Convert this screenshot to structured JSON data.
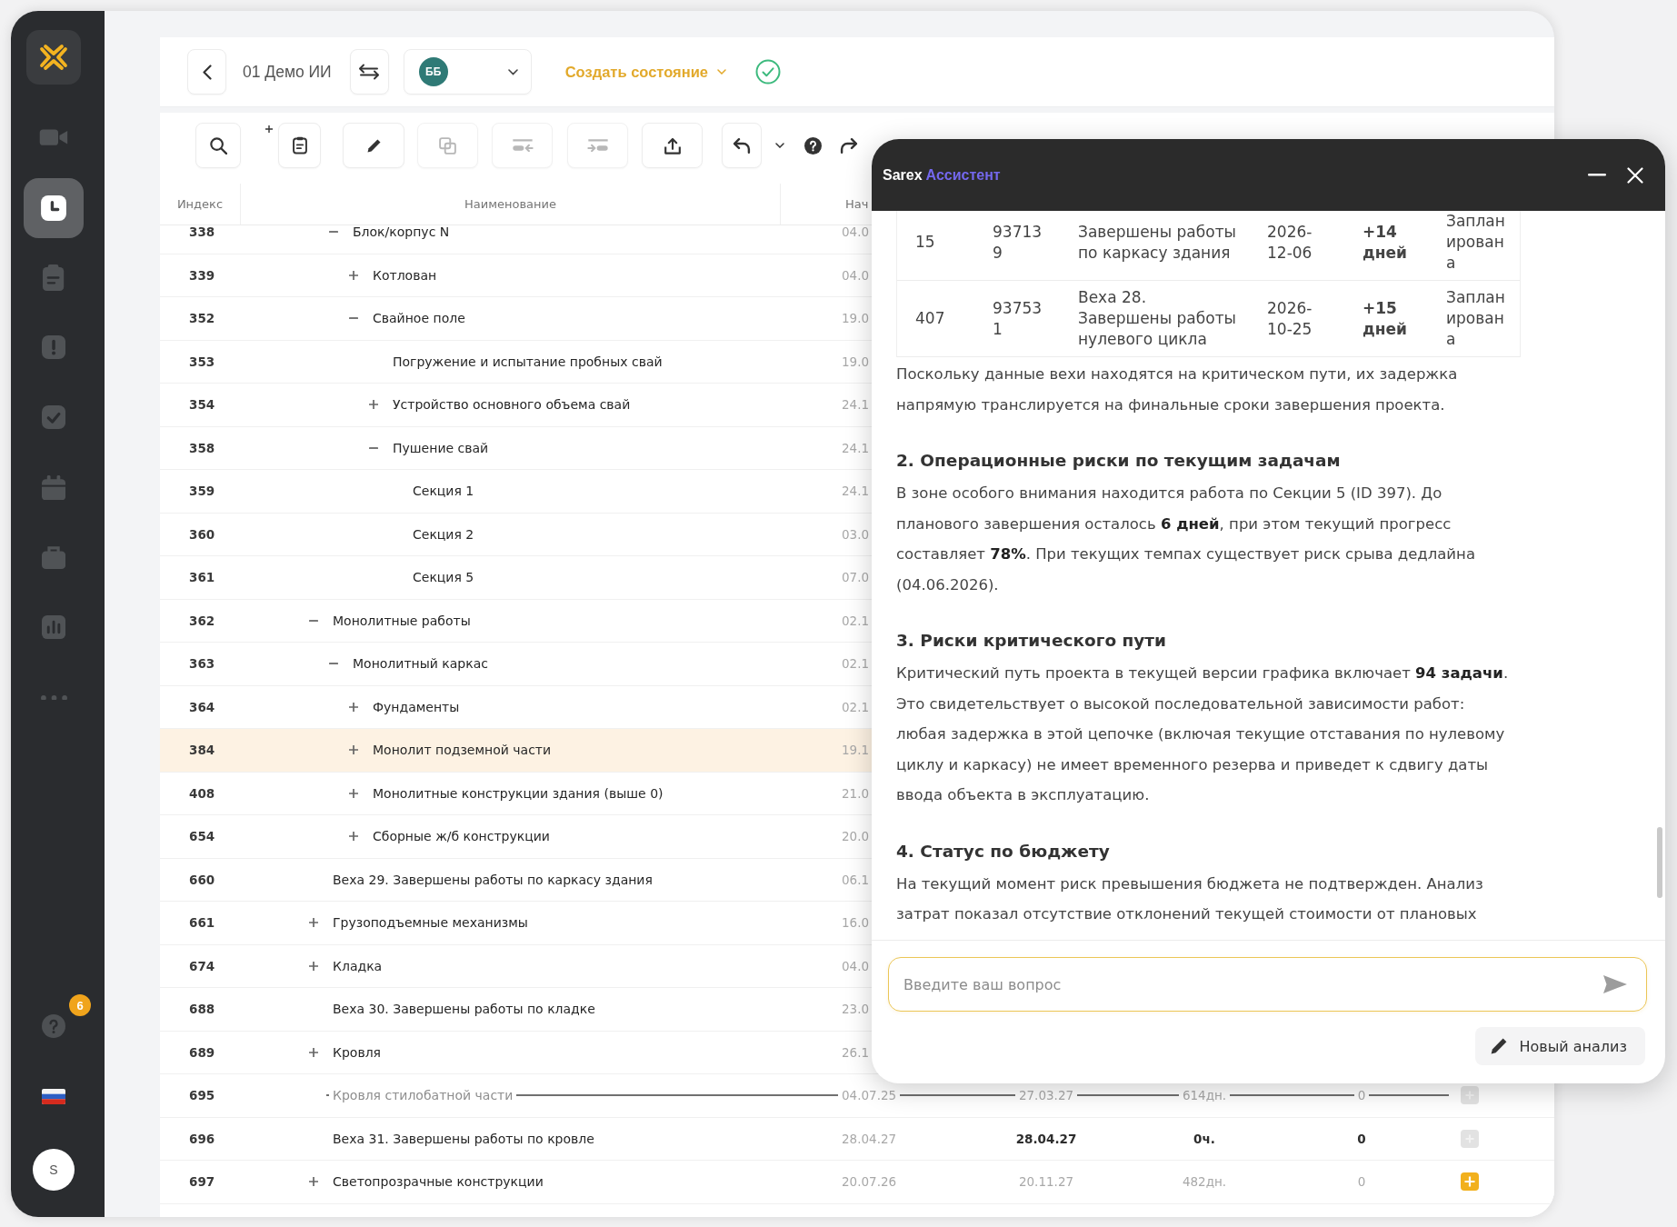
{
  "sidebar": {
    "nav_items": [
      {
        "selected": false
      },
      {
        "selected": true
      },
      {
        "selected": false
      },
      {
        "selected": false
      },
      {
        "selected": false
      },
      {
        "selected": false
      },
      {
        "selected": false
      },
      {
        "selected": false
      },
      {
        "selected": false
      }
    ],
    "help_badge": "6",
    "user_initial": "S"
  },
  "header": {
    "project_title": "01 Демо ИИ",
    "user_initials": "ББ",
    "create_state_label": "Создать состояние"
  },
  "toolbar": {
    "buttons": [
      {
        "disabled": false
      },
      {
        "disabled": false
      },
      {
        "disabled": false
      },
      {
        "disabled": true
      },
      {
        "disabled": true
      },
      {
        "disabled": true
      },
      {
        "disabled": false
      },
      {
        "disabled": false
      },
      {
        "disabled": false
      },
      {
        "disabled": false
      },
      {
        "disabled": false
      }
    ]
  },
  "table": {
    "columns": [
      "Индекс",
      "Наименование",
      "Нач"
    ],
    "rows": [
      {
        "children": [
          {
            "index": "338",
            "name": "Блок/корпус N",
            "expanded": true,
            "selected": false,
            "struck_out": false,
            "cells": [
              {
                "text": "04.0",
                "muted": true
              }
            ],
            "children": [
              {
                "index": "339",
                "name": "Котлован",
                "expanded": false,
                "selected": false,
                "struck_out": false,
                "cells": [
                  {
                    "text": "04.0",
                    "muted": true
                  }
                ]
              },
              {
                "index": "352",
                "name": "Свайное поле",
                "expanded": true,
                "selected": false,
                "struck_out": false,
                "cells": [
                  {
                    "text": "19.0",
                    "muted": true
                  }
                ],
                "children": [
                  {
                    "index": "353",
                    "name": "Погружение и испытание пробных свай",
                    "selected": false,
                    "struck_out": false,
                    "cells": [
                      {
                        "text": "19.0",
                        "muted": true
                      }
                    ]
                  },
                  {
                    "index": "354",
                    "name": "Устройство основного объема свай",
                    "expanded": false,
                    "selected": false,
                    "struck_out": false,
                    "cells": [
                      {
                        "text": "24.1",
                        "muted": true
                      }
                    ]
                  },
                  {
                    "index": "358",
                    "name": "Пушение свай",
                    "expanded": true,
                    "selected": false,
                    "struck_out": false,
                    "cells": [
                      {
                        "text": "24.1",
                        "muted": true
                      }
                    ],
                    "children": [
                      {
                        "index": "359",
                        "name": "Секция 1",
                        "selected": false,
                        "struck_out": false,
                        "cells": [
                          {
                            "text": "24.1",
                            "muted": true
                          }
                        ]
                      },
                      {
                        "index": "360",
                        "name": "Секция 2",
                        "selected": false,
                        "struck_out": false,
                        "cells": [
                          {
                            "text": "03.0",
                            "muted": true
                          }
                        ]
                      },
                      {
                        "index": "361",
                        "name": "Секция 5",
                        "selected": false,
                        "struck_out": false,
                        "cells": [
                          {
                            "text": "07.0",
                            "muted": true
                          }
                        ]
                      }
                    ]
                  }
                ]
              }
            ]
          }
        ]
      },
      {
        "index": "362",
        "name": "Монолитные работы",
        "expanded": true,
        "selected": false,
        "struck_out": false,
        "cells": [
          {
            "text": "02.1",
            "muted": true
          }
        ],
        "children": [
          {
            "index": "363",
            "name": "Монолитный каркас",
            "expanded": true,
            "selected": false,
            "struck_out": false,
            "cells": [
              {
                "text": "02.1",
                "muted": true
              }
            ],
            "children": [
              {
                "index": "364",
                "name": "Фундаменты",
                "expanded": false,
                "selected": false,
                "struck_out": false,
                "cells": [
                  {
                    "text": "02.1",
                    "muted": true
                  }
                ]
              },
              {
                "index": "384",
                "name": "Монолит подземной части",
                "expanded": false,
                "selected": true,
                "struck_out": false,
                "cells": [
                  {
                    "text": "19.1",
                    "muted": true
                  }
                ]
              },
              {
                "index": "408",
                "name": "Монолитные конструкции здания (выше 0)",
                "expanded": false,
                "selected": false,
                "struck_out": false,
                "cells": [
                  {
                    "text": "21.0",
                    "muted": true
                  }
                ]
              },
              {
                "index": "654",
                "name": "Сборные ж/б конструкции",
                "expanded": false,
                "selected": false,
                "struck_out": false,
                "cells": [
                  {
                    "text": "20.0",
                    "muted": true
                  }
                ]
              }
            ]
          }
        ]
      },
      {
        "index": "660",
        "name": "Веха 29. Завершены работы по каркасу здания",
        "selected": false,
        "struck_out": false,
        "cells": [
          {
            "text": "06.1",
            "muted": true
          }
        ]
      },
      {
        "index": "661",
        "name": "Грузоподъемные механизмы",
        "expanded": false,
        "selected": false,
        "struck_out": false,
        "cells": [
          {
            "text": "16.0",
            "muted": true
          }
        ]
      },
      {
        "index": "674",
        "name": "Кладка",
        "expanded": false,
        "selected": false,
        "struck_out": false,
        "cells": [
          {
            "text": "04.0",
            "muted": true
          }
        ]
      },
      {
        "index": "688",
        "name": "Веха 30. Завершены работы по кладке",
        "selected": false,
        "struck_out": false,
        "cells": [
          {
            "text": "23.0",
            "muted": true
          }
        ]
      },
      {
        "index": "689",
        "name": "Кровля",
        "expanded": false,
        "selected": false,
        "struck_out": false,
        "cells": [
          {
            "text": "26.1",
            "muted": true
          }
        ]
      },
      {
        "index": "695",
        "name": "Кровля стилобатной части",
        "selected": false,
        "struck_out": true,
        "cells": [
          {
            "text": "04.07.25",
            "muted": true
          },
          {
            "text": "27.03.27",
            "muted": true
          },
          {
            "text": "614дн.",
            "muted": true
          },
          {
            "text": "0",
            "muted": true
          }
        ],
        "action_enabled": false
      },
      {
        "index": "696",
        "name": "Веха 31. Завершены работы по кровле",
        "selected": false,
        "struck_out": false,
        "cells": [
          {
            "text": "28.04.27",
            "muted": true
          },
          {
            "text": "28.04.27",
            "muted": false
          },
          {
            "text": "0ч.",
            "muted": false
          },
          {
            "text": "0",
            "muted": false
          }
        ],
        "action_enabled": false
      },
      {
        "index": "697",
        "name": "Светопрозрачные конструкции",
        "expanded": false,
        "selected": false,
        "struck_out": false,
        "cells": [
          {
            "text": "20.07.26",
            "muted": true
          },
          {
            "text": "20.11.27",
            "muted": true
          },
          {
            "text": "482дн.",
            "muted": true
          },
          {
            "text": "0",
            "muted": true
          }
        ],
        "action_enabled": true
      }
    ]
  },
  "assistant": {
    "brand": "Sarex",
    "title": "Ассистент",
    "content": [
      {
        "kind": "table",
        "rows": [
          [
            "15",
            "937139",
            "Завершены работы по каркасу здания",
            "2026-12-06",
            "+14 дней",
            "Запланирована"
          ],
          [
            "407",
            "937531",
            "Веха 28. Завершены работы нулевого цикла",
            "2026-10-25",
            "+15 дней",
            "Запланирована"
          ]
        ]
      },
      {
        "kind": "paragraph",
        "text": "Поскольку данные вехи находятся на критическом пути, их задержка напрямую транслируется на финальные сроки завершения проекта."
      },
      {
        "kind": "heading",
        "text": "2. Операционные риски по текущим задачам"
      },
      {
        "kind": "paragraph",
        "text": "В зоне особого внимания находится работа по Секции 5 (ID 397). До планового завершения осталось **6 дней**, при этом текущий прогресс составляет **78%**. При текущих темпах существует риск срыва дедлайна (04.06.2026)."
      },
      {
        "kind": "heading",
        "text": "3. Риски критического пути"
      },
      {
        "kind": "paragraph",
        "text": "Критический путь проекта в текущей версии графика включает **94 задачи**. Это свидетельствует о высокой последовательной зависимости работ: любая задержка в этой цепочке (включая текущие отставания по нулевому циклу и каркасу) не имеет временного резерва и приведет к сдвигу даты ввода объекта в эксплуатацию."
      },
      {
        "kind": "heading",
        "text": "4. Статус по бюджету"
      },
      {
        "kind": "paragraph",
        "text": "На текущий момент риск превышения бюджета не подтвержден. Анализ затрат показал отсутствие отклонений текущей стоимости от плановых"
      }
    ],
    "input": {
      "placeholder": "Введите ваш вопрос"
    },
    "new_analysis_button": "Новый анализ"
  }
}
